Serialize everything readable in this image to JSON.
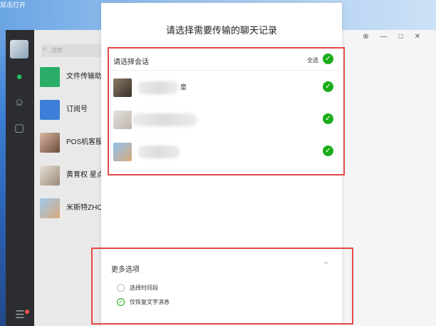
{
  "desktop": {
    "caption": "双击打开"
  },
  "search": {
    "placeholder": "搜索"
  },
  "icons": {
    "chat": "chat-bubble-icon",
    "contacts": "contacts-icon",
    "favorites": "cube-icon",
    "menu": "menu-icon",
    "search": "search-icon",
    "checkmark": "check-icon",
    "chevron": "chevron-up-icon"
  },
  "chat_list": [
    {
      "name": "文件传输助"
    },
    {
      "name": "订阅号"
    },
    {
      "name": "POS机客服"
    },
    {
      "name": "黄育权 星点"
    },
    {
      "name": "米斯特ZHO"
    }
  ],
  "dialog": {
    "title": "请选择需要传输的聊天记录",
    "session_header": "请选择会话",
    "select_all": "全选",
    "sessions": [
      {
        "suffix": "童"
      },
      {
        "suffix": ""
      },
      {
        "suffix": ""
      }
    ],
    "more_options": {
      "title": "更多选项",
      "options": [
        {
          "label": "选择时间段",
          "selected": false
        },
        {
          "label": "仅恢复文字消息",
          "selected": true
        }
      ]
    }
  },
  "colors": {
    "accent_green": "#1aad19",
    "highlight_red": "#e34848",
    "sidebar": "#2b2d30"
  }
}
